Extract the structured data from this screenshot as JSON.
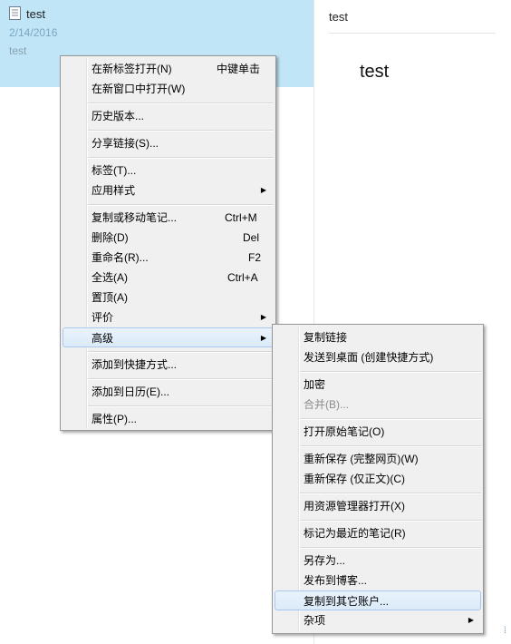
{
  "note_list": {
    "card": {
      "title": "test",
      "date": "2/14/2016",
      "snippet": "test"
    }
  },
  "editor": {
    "title": "test",
    "body": "test"
  },
  "corner_glyph": "⁞",
  "context_menu": {
    "items": {
      "open_new_tab": {
        "label": "在新标签打开(N)",
        "shortcut": "中键单击"
      },
      "open_new_window": {
        "label": "在新窗口中打开(W)"
      },
      "history": {
        "label": "历史版本..."
      },
      "share_link": {
        "label": "分享链接(S)..."
      },
      "tags": {
        "label": "标签(T)..."
      },
      "apply_style": {
        "label": "应用样式"
      },
      "copy_move": {
        "label": "复制或移动笔记...",
        "shortcut": "Ctrl+M"
      },
      "delete": {
        "label": "删除(D)",
        "shortcut": "Del"
      },
      "rename": {
        "label": "重命名(R)...",
        "shortcut": "F2"
      },
      "select_all": {
        "label": "全选(A)",
        "shortcut": "Ctrl+A"
      },
      "pin_top": {
        "label": "置顶(A)"
      },
      "rating": {
        "label": "评价"
      },
      "advanced": {
        "label": "高级"
      },
      "add_shortcut": {
        "label": "添加到快捷方式..."
      },
      "add_calendar": {
        "label": "添加到日历(E)..."
      },
      "properties": {
        "label": "属性(P)..."
      }
    }
  },
  "submenu": {
    "items": {
      "copy_link": {
        "label": "复制链接"
      },
      "send_desktop": {
        "label": "发送到桌面 (创建快捷方式)"
      },
      "encrypt": {
        "label": "加密"
      },
      "merge": {
        "label": "合并(B)..."
      },
      "open_original": {
        "label": "打开原始笔记(O)"
      },
      "resave_full": {
        "label": "重新保存 (完整网页)(W)"
      },
      "resave_text": {
        "label": "重新保存 (仅正文)(C)"
      },
      "open_explorer": {
        "label": "用资源管理器打开(X)"
      },
      "mark_recent": {
        "label": "标记为最近的笔记(R)"
      },
      "save_as": {
        "label": "另存为..."
      },
      "publish_blog": {
        "label": "发布到博客..."
      },
      "copy_account": {
        "label": "复制到其它账户..."
      },
      "misc": {
        "label": "杂项"
      }
    }
  }
}
